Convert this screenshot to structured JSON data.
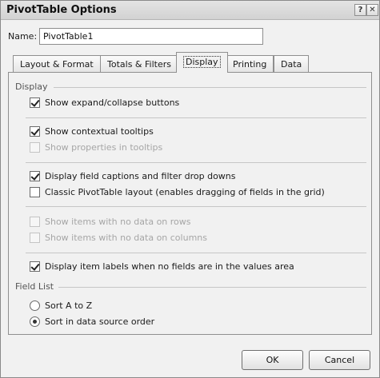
{
  "window": {
    "title": "PivotTable Options",
    "help_glyph": "?",
    "close_glyph": "✕"
  },
  "name_field": {
    "label": "Name:",
    "value": "PivotTable1"
  },
  "tabs": [
    {
      "label": "Layout & Format",
      "active": false
    },
    {
      "label": "Totals & Filters",
      "active": false
    },
    {
      "label": "Display",
      "active": true
    },
    {
      "label": "Printing",
      "active": false
    },
    {
      "label": "Data",
      "active": false
    }
  ],
  "display_group": {
    "label": "Display",
    "options": [
      {
        "label": "Show expand/collapse buttons",
        "checked": true,
        "enabled": true
      },
      {
        "label": "Show contextual tooltips",
        "checked": true,
        "enabled": true
      },
      {
        "label": "Show properties in tooltips",
        "checked": false,
        "enabled": false
      },
      {
        "label": "Display field captions and filter drop downs",
        "checked": true,
        "enabled": true
      },
      {
        "label": "Classic PivotTable layout (enables dragging of fields in the grid)",
        "checked": false,
        "enabled": true
      },
      {
        "label": "Show items with no data on rows",
        "checked": false,
        "enabled": false
      },
      {
        "label": "Show items with no data on columns",
        "checked": false,
        "enabled": false
      },
      {
        "label": "Display item labels when no fields are in the values area",
        "checked": true,
        "enabled": true
      }
    ]
  },
  "field_list_group": {
    "label": "Field List",
    "options": [
      {
        "label": "Sort A to Z",
        "selected": false
      },
      {
        "label": "Sort in data source order",
        "selected": true
      }
    ]
  },
  "buttons": {
    "ok": "OK",
    "cancel": "Cancel"
  }
}
